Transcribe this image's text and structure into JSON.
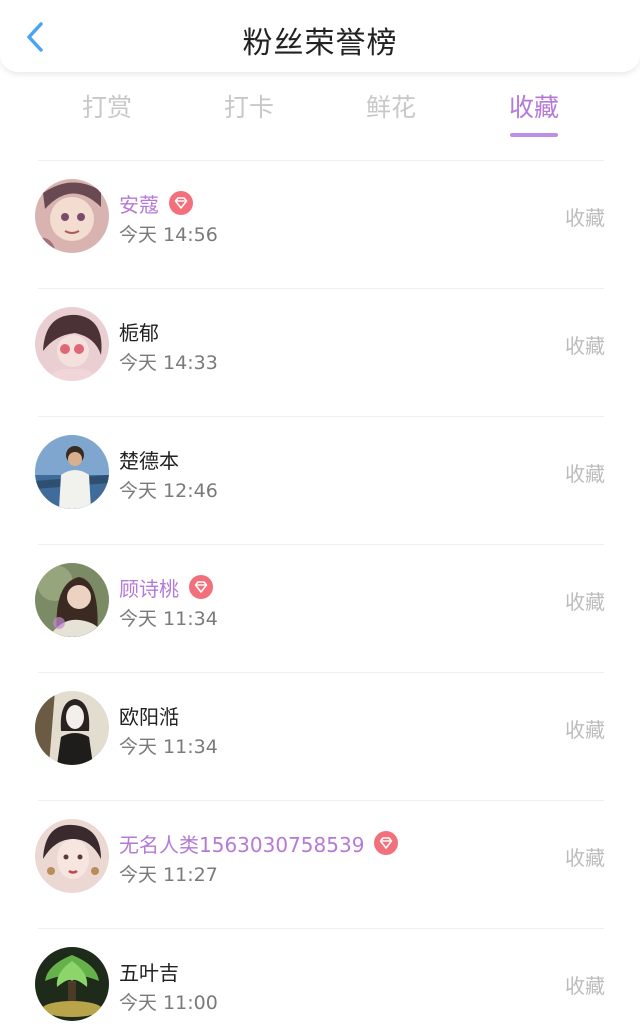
{
  "header": {
    "title": "粉丝荣誉榜"
  },
  "tabs": [
    {
      "label": "打赏"
    },
    {
      "label": "打卡"
    },
    {
      "label": "鲜花"
    },
    {
      "label": "收藏"
    }
  ],
  "active_tab": "收藏",
  "colors": {
    "accent": "#b57ad8",
    "vip_badge": "#f26f7c",
    "back_arrow": "#4aa3f5",
    "primary_text": "#222222",
    "secondary_text": "#7a7a7a",
    "muted_text": "#bcbcbc"
  },
  "fans": [
    {
      "name": "安蔻",
      "time": "今天 14:56",
      "action": "收藏",
      "vip": true
    },
    {
      "name": "栀郁",
      "time": "今天 14:33",
      "action": "收藏",
      "vip": false
    },
    {
      "name": "楚德本",
      "time": "今天 12:46",
      "action": "收藏",
      "vip": false
    },
    {
      "name": "顾诗桃",
      "time": "今天 11:34",
      "action": "收藏",
      "vip": true
    },
    {
      "name": "欧阳湉",
      "time": "今天 11:34",
      "action": "收藏",
      "vip": false
    },
    {
      "name": "无名人类1563030758539",
      "time": "今天 11:27",
      "action": "收藏",
      "vip": true
    },
    {
      "name": "五叶吉",
      "time": "今天 11:00",
      "action": "收藏",
      "vip": false
    }
  ]
}
